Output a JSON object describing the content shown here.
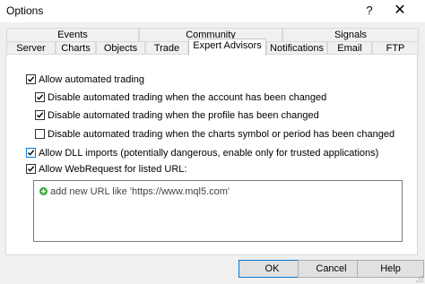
{
  "window": {
    "title": "Options",
    "help": "?",
    "close": "✕"
  },
  "tabs_row1": [
    "Events",
    "Community",
    "Signals"
  ],
  "tabs_row2": [
    "Server",
    "Charts",
    "Objects",
    "Trade",
    "Expert Advisors",
    "Notifications",
    "Email",
    "FTP"
  ],
  "active_tab": "Expert Advisors",
  "options": {
    "allow_automated": {
      "label": "Allow automated trading",
      "checked": true
    },
    "disable_account": {
      "label": "Disable automated trading when the account has been changed",
      "checked": true
    },
    "disable_profile": {
      "label": "Disable automated trading when the profile has been changed",
      "checked": true
    },
    "disable_symbol": {
      "label": "Disable automated trading when the charts symbol or period has been changed",
      "checked": false
    },
    "allow_dll": {
      "label": "Allow DLL imports (potentially dangerous, enable only for trusted applications)",
      "checked": true
    },
    "allow_webrequest": {
      "label": "Allow WebRequest for listed URL:",
      "checked": true
    }
  },
  "url_list": {
    "add_text": "add new URL like 'https://www.mql5.com'"
  },
  "buttons": {
    "ok": "OK",
    "cancel": "Cancel",
    "help": "Help"
  },
  "colors": {
    "check_border_highlight": "#0078d7",
    "add_icon_green": "#3ca83c"
  }
}
